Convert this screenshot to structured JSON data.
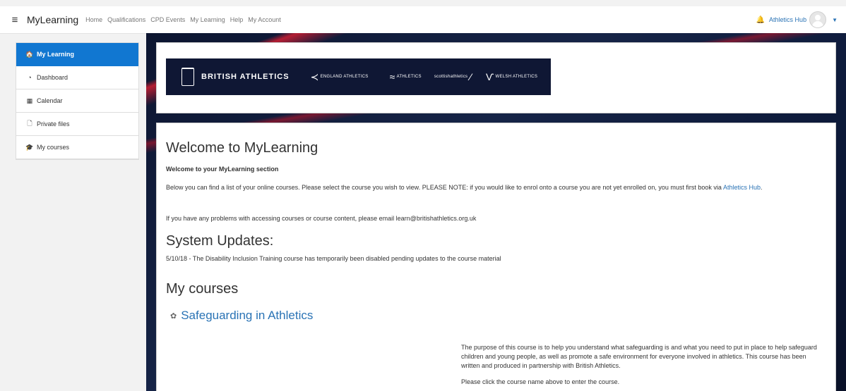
{
  "navbar": {
    "brand": "MyLearning",
    "links": [
      "Home",
      "Qualifications",
      "CPD Events",
      "My Learning",
      "Help",
      "My Account"
    ],
    "hub_label": "Athletics Hub",
    "icons": {
      "menu": "hamburger-icon",
      "bell": "bell-icon",
      "avatar": "user-avatar",
      "caret": "caret-down-icon"
    }
  },
  "sidebar": {
    "items": [
      {
        "label": "My Learning",
        "icon": "home-icon",
        "glyph": "🏠"
      },
      {
        "label": "Dashboard",
        "icon": "dashboard-icon",
        "glyph": "◔"
      },
      {
        "label": "Calendar",
        "icon": "calendar-icon",
        "glyph": "▦"
      },
      {
        "label": "Private files",
        "icon": "file-icon",
        "glyph": "🗋"
      },
      {
        "label": "My courses",
        "icon": "graduation-cap-icon",
        "glyph": "🎓"
      }
    ]
  },
  "banner": {
    "logos": [
      {
        "text": "BRITISH ATHLETICS"
      },
      {
        "text": "ENGLAND ATHLETICS"
      },
      {
        "text": "ATHLETICS"
      },
      {
        "text": "scottishathletics"
      },
      {
        "text": "WELSH ATHLETICS"
      }
    ]
  },
  "main": {
    "title": "Welcome to MyLearning",
    "subtitle": "Welcome to your MyLearning section",
    "intro_text": "Below you can find a list of your online courses. Please select the course you wish to view. PLEASE NOTE: if you would like to enrol onto a course you are not yet enrolled on, you must first book via",
    "intro_link": "Athletics Hub",
    "contact_text": "If you have any problems with accessing courses or course content, please email learn@britishathletics.org.uk",
    "updates_title": "System Updates:",
    "update_text": "5/10/18 - The Disability Inclusion Training course has temporarily been disabled pending updates to the course material",
    "courses_title": "My courses",
    "course": {
      "name": "Safeguarding in Athletics",
      "summary": "The purpose of this course is to help you understand what safeguarding is and what you need to put in place to help safeguard children and young people, as well as promote a safe environment for everyone involved in athletics. This course has been written and produced in partnership with British Athletics.",
      "cta": "Please click the course name above to enter the course."
    }
  },
  "colors": {
    "accent": "#1177d1",
    "link": "#2a73b5",
    "banner_bg": "#0f1734"
  }
}
